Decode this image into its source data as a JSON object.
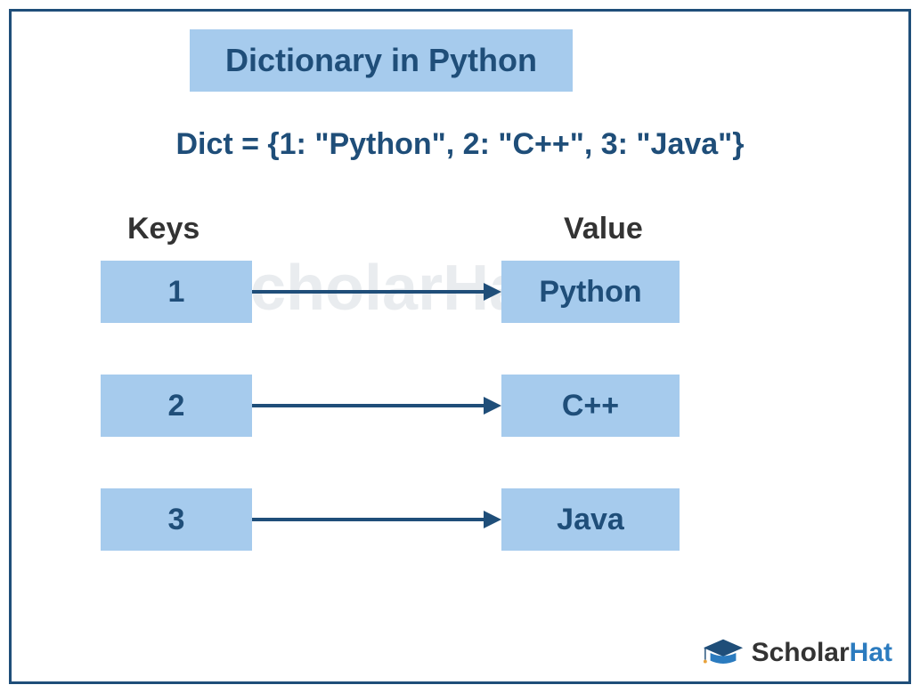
{
  "title": "Dictionary in Python",
  "code_line": "Dict = {1: \"Python\", 2: \"C++\", 3: \"Java\"}",
  "columns": {
    "keys": "Keys",
    "value": "Value"
  },
  "pairs": [
    {
      "key": "1",
      "value": "Python"
    },
    {
      "key": "2",
      "value": "C++"
    },
    {
      "key": "3",
      "value": "Java"
    }
  ],
  "watermark_text": "ScholarHat",
  "logo": {
    "prefix": "Scholar",
    "suffix": "Hat"
  },
  "colors": {
    "frame_border": "#1f4e79",
    "box_bg": "#a6cbed",
    "text_primary": "#1f4e79",
    "text_dark": "#333333",
    "logo_accent": "#2b7bbf"
  }
}
